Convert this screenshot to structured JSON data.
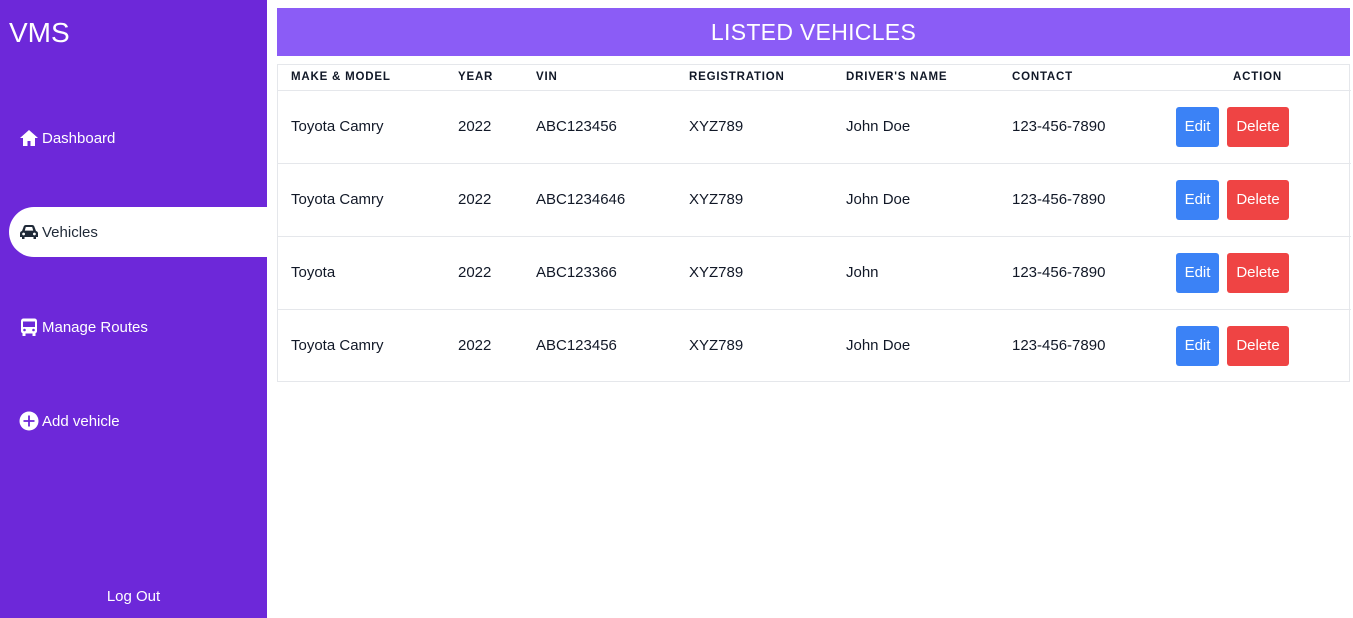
{
  "app": {
    "brand": "VMS"
  },
  "sidebar": {
    "items": [
      {
        "label": "Dashboard",
        "icon": "home-icon"
      },
      {
        "label": "Vehicles",
        "icon": "car-icon",
        "active": true
      },
      {
        "label": "Manage Routes",
        "icon": "bus-icon"
      },
      {
        "label": "Add vehicle",
        "icon": "plus-circle-icon"
      }
    ],
    "logout_label": "Log Out"
  },
  "main": {
    "title": "LISTED VEHICLES",
    "columns": [
      "MAKE & MODEL",
      "YEAR",
      "VIN",
      "REGISTRATION",
      "DRIVER'S NAME",
      "CONTACT",
      "ACTION"
    ],
    "rows": [
      {
        "make_model": "Toyota Camry",
        "year": "2022",
        "vin": "ABC123456",
        "registration": "XYZ789",
        "driver": "John Doe",
        "contact": "123-456-7890",
        "edit_label": "Edit",
        "delete_label": "Delete"
      },
      {
        "make_model": "Toyota Camry",
        "year": "2022",
        "vin": "ABC1234646",
        "registration": "XYZ789",
        "driver": "John Doe",
        "contact": "123-456-7890",
        "edit_label": "Edit",
        "delete_label": "Delete"
      },
      {
        "make_model": "Toyota",
        "year": "2022",
        "vin": "ABC123366",
        "registration": "XYZ789",
        "driver": "John",
        "contact": "123-456-7890",
        "edit_label": "Edit",
        "delete_label": "Delete"
      },
      {
        "make_model": "Toyota Camry",
        "year": "2022",
        "vin": "ABC123456",
        "registration": "XYZ789",
        "driver": "John Doe",
        "contact": "123-456-7890",
        "edit_label": "Edit",
        "delete_label": "Delete"
      }
    ]
  },
  "colors": {
    "sidebar": "#6d28d9",
    "header": "#8b5cf6",
    "edit": "#3b82f6",
    "delete": "#ef4444"
  }
}
